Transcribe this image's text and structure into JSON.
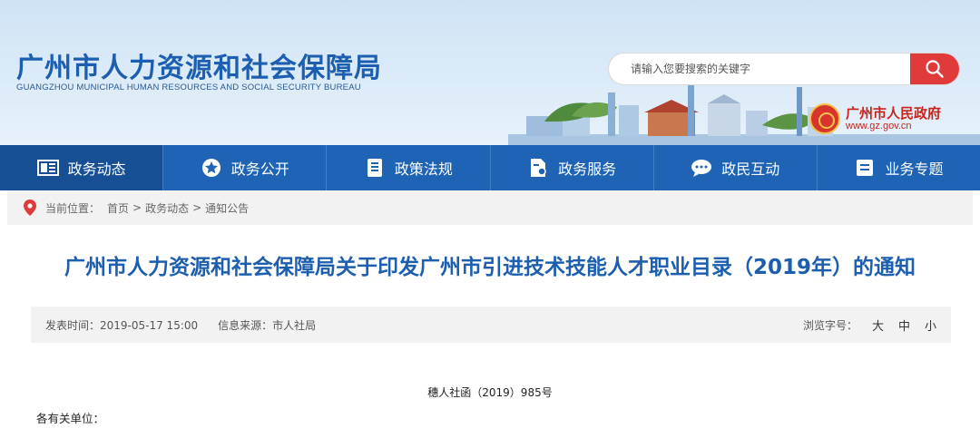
{
  "header": {
    "title_cn": "广州市人力资源和社会保障局",
    "title_en": "GUANGZHOU MUNICIPAL HUMAN RESOURCES AND SOCIAL SECURITY BUREAU",
    "search_placeholder": "请输入您要搜索的关键字",
    "gov_name": "广州市人民政府",
    "gov_url": "www.gz.gov.cn"
  },
  "nav": {
    "items": [
      {
        "label": "政务动态",
        "icon": "news-icon"
      },
      {
        "label": "政务公开",
        "icon": "star-icon"
      },
      {
        "label": "政策法规",
        "icon": "document-icon"
      },
      {
        "label": "政务服务",
        "icon": "service-icon"
      },
      {
        "label": "政民互动",
        "icon": "chat-icon"
      },
      {
        "label": "业务专题",
        "icon": "list-icon"
      }
    ]
  },
  "breadcrumb": {
    "label": "当前位置：",
    "items": [
      "首页",
      "政务动态",
      "通知公告"
    ],
    "separator": ">"
  },
  "article": {
    "title": "广州市人力资源和社会保障局关于印发广州市引进技术技能人才职业目录（2019年）的通知",
    "publish_time": "发表时间：2019-05-17 15:00",
    "source": "信息来源：市人社局",
    "font_size_label": "浏览字号：",
    "font_sizes": [
      "大",
      "中",
      "小"
    ],
    "doc_number": "穗人社函（2019）985号",
    "salutation": "各有关单位："
  },
  "colors": {
    "nav_bg": "#1f64b4",
    "title_blue": "#1d5fae",
    "search_red": "#e03a3a"
  }
}
